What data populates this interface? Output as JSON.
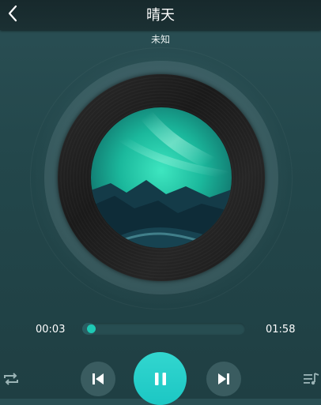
{
  "header": {
    "title": "晴天",
    "back_icon": "chevron-left-icon"
  },
  "track": {
    "artist": "未知"
  },
  "progress": {
    "current": "00:03",
    "duration": "01:58",
    "fraction": 0.025
  },
  "controls": {
    "repeat_icon": "repeat-icon",
    "prev_icon": "skip-previous-icon",
    "play_icon": "pause-icon",
    "next_icon": "skip-next-icon",
    "playlist_icon": "playlist-icon"
  },
  "colors": {
    "accent": "#1ec9b4",
    "play_button": "#22cbc6",
    "background": "#23474b"
  }
}
